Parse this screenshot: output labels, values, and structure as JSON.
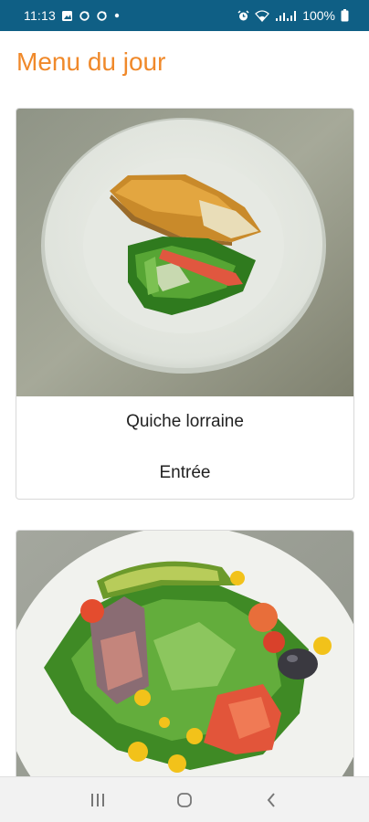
{
  "status_bar": {
    "time": "11:13",
    "battery": "100%",
    "icons": [
      "photo-icon",
      "sync-icon",
      "sync-icon",
      "dot-icon",
      "alarm-icon",
      "wifi-icon",
      "signal-icon",
      "battery-icon"
    ]
  },
  "page": {
    "title": "Menu du jour"
  },
  "menu": {
    "items": [
      {
        "name": "Quiche lorraine",
        "category": "Entrée"
      },
      {
        "name": "",
        "category": ""
      }
    ]
  },
  "nav_bar": {
    "icons": [
      "recent-apps-icon",
      "home-icon",
      "back-icon"
    ]
  },
  "colors": {
    "status_bar": "#0f5f85",
    "title": "#f0892a",
    "card_border": "#d9d9d9"
  }
}
